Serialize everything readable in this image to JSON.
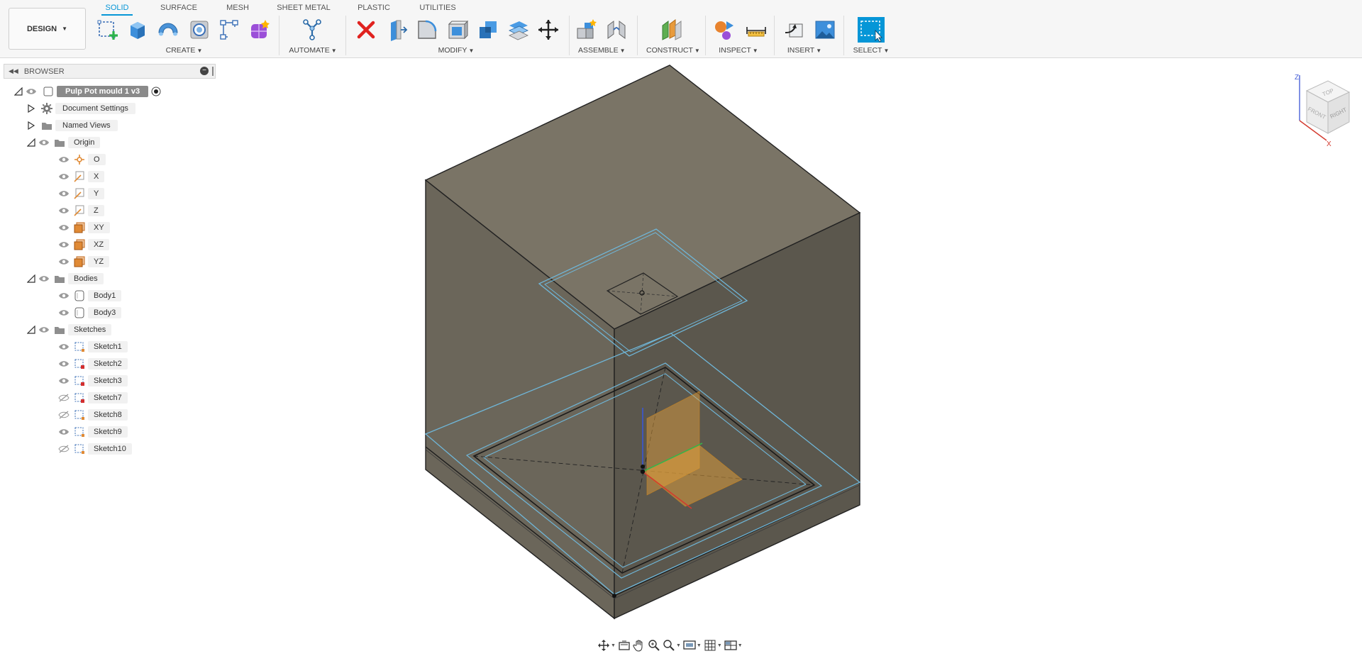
{
  "workspace": {
    "label": "DESIGN"
  },
  "tabs": [
    {
      "label": "SOLID",
      "active": true
    },
    {
      "label": "SURFACE",
      "active": false
    },
    {
      "label": "MESH",
      "active": false
    },
    {
      "label": "SHEET METAL",
      "active": false
    },
    {
      "label": "PLASTIC",
      "active": false
    },
    {
      "label": "UTILITIES",
      "active": false
    }
  ],
  "groups": {
    "create": "CREATE",
    "automate": "AUTOMATE",
    "modify": "MODIFY",
    "assemble": "ASSEMBLE",
    "construct": "CONSTRUCT",
    "inspect": "INSPECT",
    "insert": "INSERT",
    "select": "SELECT"
  },
  "browser": {
    "title": "BROWSER",
    "root": "Pulp Pot mould 1 v3",
    "document_settings": "Document Settings",
    "named_views": "Named Views",
    "origin": {
      "label": "Origin",
      "items": [
        "O",
        "X",
        "Y",
        "Z",
        "XY",
        "XZ",
        "YZ"
      ]
    },
    "bodies": {
      "label": "Bodies",
      "items": [
        "Body1",
        "Body3"
      ]
    },
    "sketches": {
      "label": "Sketches",
      "items": [
        {
          "label": "Sketch1",
          "visible": true
        },
        {
          "label": "Sketch2",
          "visible": true
        },
        {
          "label": "Sketch3",
          "visible": true
        },
        {
          "label": "Sketch7",
          "visible": false
        },
        {
          "label": "Sketch8",
          "visible": false
        },
        {
          "label": "Sketch9",
          "visible": true
        },
        {
          "label": "Sketch10",
          "visible": false
        }
      ]
    }
  },
  "viewcube": {
    "top": "TOP",
    "front": "FRONT",
    "right": "RIGHT",
    "axis_z": "Z",
    "axis_x": "X"
  },
  "colors": {
    "accent": "#0696d7",
    "model_top": "#7a7466",
    "model_left": "#6b665a",
    "model_right": "#5b574d",
    "sketch_line": "#6fb6d8",
    "origin_plane": "#e8a33c"
  },
  "icons": {
    "toolbar": [
      "new-sketch-icon",
      "extrude-icon",
      "revolve-icon",
      "hole-icon",
      "pattern-icon",
      "form-icon",
      "automate-icon",
      "delete-icon",
      "press-pull-icon",
      "fillet-icon",
      "shell-icon",
      "combine-icon",
      "offset-face-icon",
      "move-icon",
      "new-component-icon",
      "joint-icon",
      "construct-plane-icon",
      "inspect-icon",
      "measure-icon",
      "insert-derive-icon",
      "insert-image-icon",
      "select-icon"
    ],
    "navbar": [
      "orbit-icon",
      "look-at-icon",
      "pan-icon",
      "zoom-icon",
      "fit-icon",
      "display-settings-icon",
      "grid-icon",
      "viewports-icon"
    ]
  }
}
